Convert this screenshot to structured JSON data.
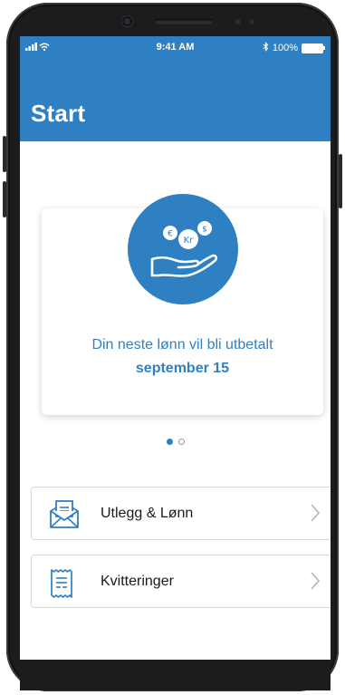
{
  "status_bar": {
    "time": "9:41 AM",
    "battery": "100%"
  },
  "header": {
    "title": "Start"
  },
  "card": {
    "text": "Din neste lønn vil bli utbetalt",
    "date": "september 15",
    "coin_symbols": [
      "€",
      "Kr",
      "$"
    ]
  },
  "pager": {
    "pages": 2,
    "active_index": 0
  },
  "list": {
    "items": [
      {
        "label": "Utlegg & Lønn",
        "icon": "envelope-document-icon"
      },
      {
        "label": "Kvitteringer",
        "icon": "receipt-icon"
      }
    ]
  },
  "colors": {
    "brand": "#2f80c3",
    "border": "#d7d7d7"
  }
}
